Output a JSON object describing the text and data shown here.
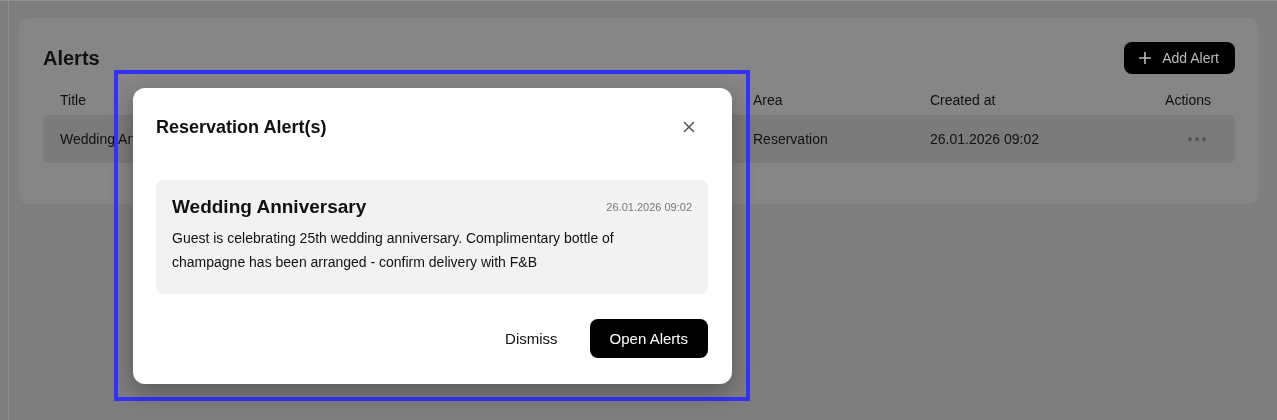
{
  "page": {
    "title": "Alerts",
    "add_button": {
      "label": "Add Alert"
    }
  },
  "table": {
    "columns": [
      "Title",
      "Area",
      "Created at",
      "Actions"
    ],
    "rows": [
      {
        "title": "Wedding An",
        "area": "Reservation",
        "created_at": "26.01.2026 09:02"
      }
    ]
  },
  "dialog": {
    "title": "Reservation Alert(s)",
    "alerts": [
      {
        "title": "Wedding Anniversary",
        "time": "26.01.2026 09:02",
        "message": "Guest is celebrating 25th wedding anniversary. Complimentary bottle of champagne has been arranged - confirm delivery with F&B"
      }
    ],
    "buttons": [
      {
        "label": "Dismiss",
        "kind": "secondary"
      },
      {
        "label": "Open Alerts",
        "kind": "primary"
      }
    ]
  }
}
